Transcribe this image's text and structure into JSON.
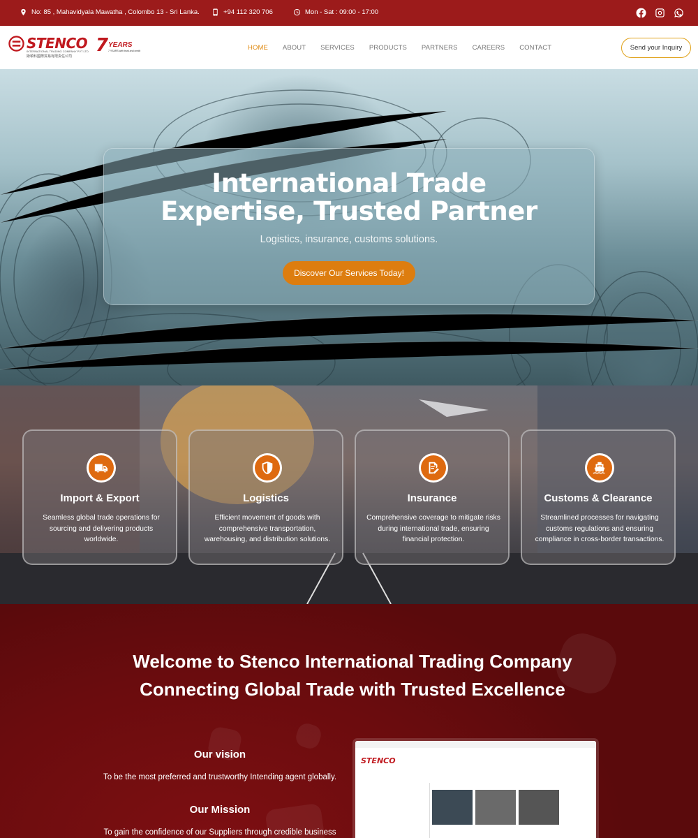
{
  "topbar": {
    "address": "No: 85 , Mahavidyala Mawatha , Colombo 13 - Sri Lanka.",
    "phone": "+94 112 320 706",
    "hours": "Mon - Sat : 09:00 - 17:00",
    "social": [
      "facebook-icon",
      "instagram-icon",
      "whatsapp-icon"
    ]
  },
  "header": {
    "logo_text": "STENCO",
    "logo_sub": "INTERNATIONAL TRADING COMPANY PVT LTD",
    "logo_chinese": "斯顿科國際貿易有限责任公司",
    "years_number": "7",
    "years_label": "YEARS",
    "years_tagline": "7 YEARS with trust and credit",
    "nav": [
      "HOME",
      "ABOUT",
      "SERVICES",
      "PRODUCTS",
      "PARTNERS",
      "CAREERS",
      "CONTACT"
    ],
    "active_nav": "HOME",
    "inquiry_button": "Send your Inquiry"
  },
  "hero": {
    "title_line1": "International Trade",
    "title_line2": "Expertise, Trusted Partner",
    "subtitle": "Logistics, insurance, customs solutions.",
    "cta": "Discover Our Services Today!"
  },
  "services": [
    {
      "icon": "truck-icon",
      "title": "Import & Export",
      "desc": "Seamless global trade operations for sourcing and delivering products worldwide."
    },
    {
      "icon": "shield-icon",
      "title": "Logistics",
      "desc": "Efficient movement of goods with comprehensive transportation, warehousing, and distribution solutions."
    },
    {
      "icon": "document-pen-icon",
      "title": "Insurance",
      "desc": "Comprehensive coverage to mitigate risks during international trade, ensuring financial protection."
    },
    {
      "icon": "ship-icon",
      "title": "Customs & Clearance",
      "desc": "Streamlined processes for navigating customs regulations and ensuring compliance in cross-border transactions."
    }
  ],
  "welcome": {
    "title_line1": "Welcome to Stenco International Trading Company",
    "title_line2": "Connecting Global Trade with Trusted Excellence",
    "vision_heading": "Our vision",
    "vision_text": "To be the most preferred and trustworthy Intending agent globally.",
    "mission_heading": "Our Mission",
    "mission_text": "To gain the confidence of our Suppliers through credible business",
    "preview_logo": "STENCO"
  },
  "colors": {
    "brand_red": "#9c1b1b",
    "accent_orange": "#dd7d0f",
    "nav_active": "#e08a12",
    "welcome_bg": "#6b0c0e"
  }
}
